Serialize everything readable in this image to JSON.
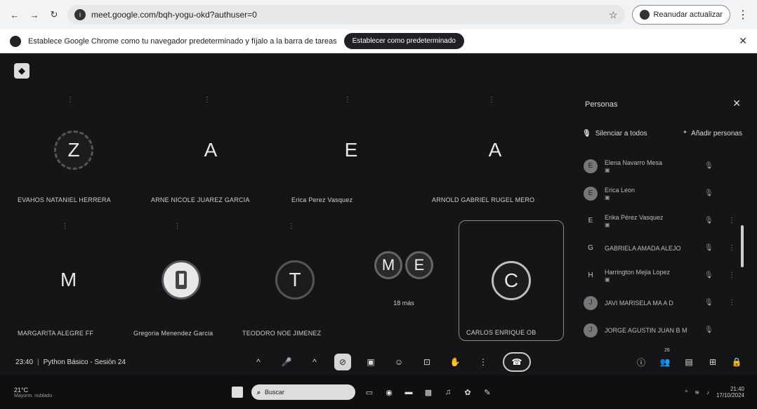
{
  "browser": {
    "nav": [
      "←",
      "→",
      "↻"
    ],
    "url": "meet.google.com/bqh-yogu-okd?authuser=0",
    "profile": "Reanudar actualizar",
    "banner_text": "Establece Google Chrome como tu navegador predeterminado y fíjalo a la barra de tareas",
    "banner_button": "Establecer como predeterminado"
  },
  "meet": {
    "logo": "◆",
    "tiles_row1": [
      {
        "initial": "Z",
        "name": "EVAHOS NATANIEL HERRERA",
        "ring": true,
        "dashed": true
      },
      {
        "initial": "A",
        "name": "ARNE NICOLE JUAREZ GARCIA",
        "ring": false
      },
      {
        "initial": "E",
        "name": "Erica Perez Vasquez",
        "ring": false
      },
      {
        "initial": "A",
        "name": "ARNOLD GABRIEL RUGEL MERO",
        "ring": false
      }
    ],
    "tiles_row2": [
      {
        "initial": "M",
        "name": "MARGARITA ALEGRE FF",
        "ring": false
      },
      {
        "initial": "",
        "name": "Gregoria Menendez Garcia",
        "ring": true,
        "image": true
      },
      {
        "initial": "T",
        "name": "TEODORO NOE JIMENEZ",
        "ring": true
      }
    ],
    "group_tile": {
      "initials": [
        "M",
        "E"
      ],
      "more": "18 más"
    },
    "presenter": {
      "initial": "C",
      "name": "CARLOS ENRIQUE OB"
    }
  },
  "panel": {
    "title": "Personas",
    "close": "✕",
    "mute_all": "Silenciar a todos",
    "add_people": "Añadir personas",
    "people": [
      {
        "avatar": "E",
        "name": "Elena Navarro Mesa",
        "sub": "▣"
      },
      {
        "avatar": "E",
        "name": "Erica Leon",
        "sub": "▣"
      },
      {
        "avatar": "E",
        "name": "Erika Pérez Vasquez",
        "sub": "▣",
        "plain": true
      },
      {
        "avatar": "G",
        "name": "GABRIELA AMADA ALEJO",
        "sub": "",
        "plain": true
      },
      {
        "avatar": "H",
        "name": "Harrington Mejia Lopez",
        "sub": "▣",
        "plain": true
      },
      {
        "avatar": "J",
        "name": "JAVI MARISELA MA A D",
        "sub": ""
      },
      {
        "avatar": "J",
        "name": "JORGE AGUSTIN JUAN B M",
        "sub": ""
      }
    ]
  },
  "bottom_bar": {
    "time": "23:40",
    "separator": "|",
    "meeting_title": "Python Básico - Sesión 24",
    "participant_count": "26"
  },
  "taskbar": {
    "weather": "21°C",
    "weather_sub": "Mayorm. nublado",
    "search": "Buscar",
    "clock_time": "21:40",
    "clock_date": "17/10/2024"
  }
}
